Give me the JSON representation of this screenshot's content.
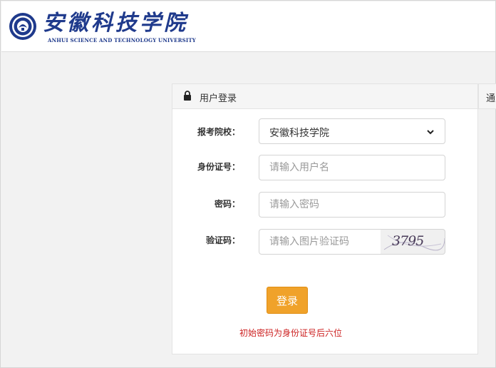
{
  "header": {
    "logo_cn": "安徽科技学院",
    "logo_en": "ANHUI SCIENCE AND TECHNOLOGY UNIVERSITY"
  },
  "login_panel": {
    "title": "用户登录",
    "school_label": "报考院校：",
    "school_value": "安徽科技学院",
    "id_label": "身份证号：",
    "id_placeholder": "请输入用户名",
    "password_label": "密码：",
    "password_placeholder": "请输入密码",
    "captcha_label": "验证码：",
    "captcha_placeholder": "请输入图片验证码",
    "captcha_text": "3795",
    "login_button": "登录",
    "hint": "初始密码为身份证号后六位"
  },
  "side_panel": {
    "title_partial": "通"
  },
  "colors": {
    "brand_blue": "#1f3a8c",
    "login_button": "#f0a22a",
    "hint_red": "#cc1f1f"
  },
  "icons": {
    "lock": "lock-icon",
    "chevron": "chevron-down-icon",
    "emblem": "university-emblem"
  }
}
